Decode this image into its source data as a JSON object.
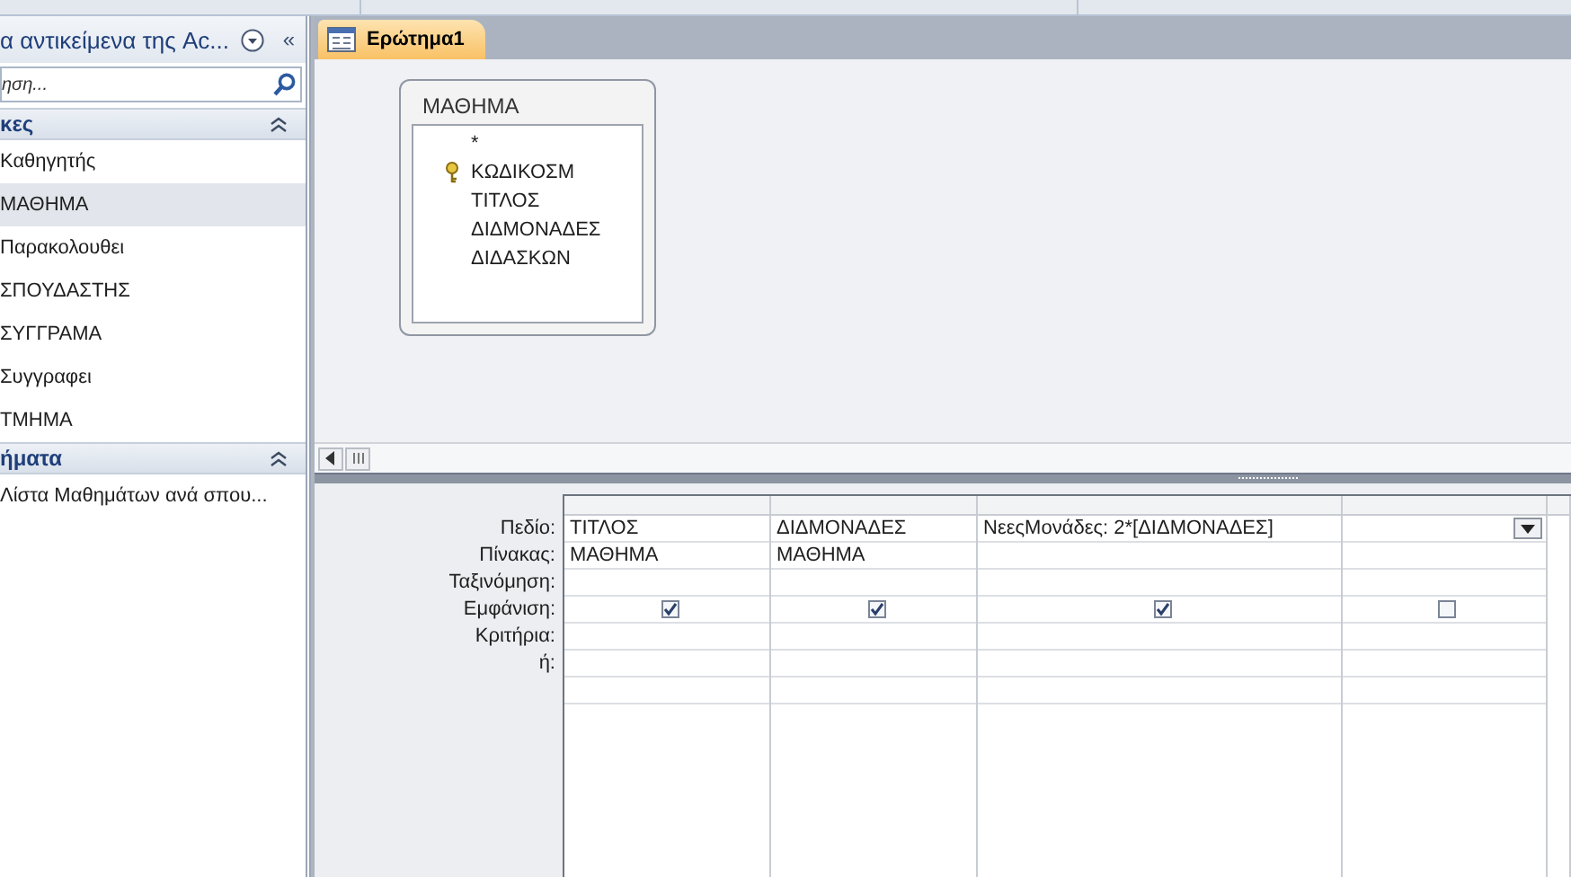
{
  "nav": {
    "title": "α αντικείμενα της Ac...",
    "collapse_label": "«",
    "search": {
      "placeholder": "ηση..."
    },
    "groups": [
      {
        "title": "κες",
        "expanded": true,
        "items": [
          {
            "label": "Καθηγητής",
            "selected": false
          },
          {
            "label": "ΜΑΘΗΜΑ",
            "selected": true
          },
          {
            "label": "Παρακολουθει",
            "selected": false
          },
          {
            "label": "ΣΠΟΥΔΑΣΤΗΣ",
            "selected": false
          },
          {
            "label": "ΣΥΓΓΡΑΜΑ",
            "selected": false
          },
          {
            "label": "Συγγραφει",
            "selected": false
          },
          {
            "label": "ΤΜΗΜΑ",
            "selected": false
          }
        ]
      },
      {
        "title": "ήματα",
        "expanded": true,
        "items": [
          {
            "label": "Λίστα Μαθημάτων ανά σπου...",
            "selected": false
          }
        ]
      }
    ]
  },
  "tabs": [
    {
      "label": "Ερώτημα1",
      "selected": true
    }
  ],
  "table_box": {
    "title": "ΜΑΘΗΜΑ",
    "fields": [
      {
        "name": "*",
        "primary_key": false
      },
      {
        "name": "ΚΩΔΙΚΟΣΜ",
        "primary_key": true
      },
      {
        "name": "ΤΙΤΛΟΣ",
        "primary_key": false
      },
      {
        "name": "ΔΙΔΜΟΝΑΔΕΣ",
        "primary_key": false
      },
      {
        "name": "ΔΙΔΑΣΚΩΝ",
        "primary_key": false
      }
    ]
  },
  "grid": {
    "row_labels": [
      "Πεδίο:",
      "Πίνακας:",
      "Ταξινόμηση:",
      "Εμφάνιση:",
      "Κριτήρια:",
      "ή:"
    ],
    "columns": [
      {
        "field": "ΤΙΤΛΟΣ",
        "table": "ΜΑΘΗΜΑ",
        "show": true,
        "dropdown": false
      },
      {
        "field": "ΔΙΔΜΟΝΑΔΕΣ",
        "table": "ΜΑΘΗΜΑ",
        "show": true,
        "dropdown": false
      },
      {
        "field": "ΝεεςΜονάδες: 2*[ΔΙΔΜΟΝΑΔΕΣ]",
        "show": true,
        "dropdown": false
      },
      {
        "show": false,
        "dropdown": true
      }
    ]
  }
}
